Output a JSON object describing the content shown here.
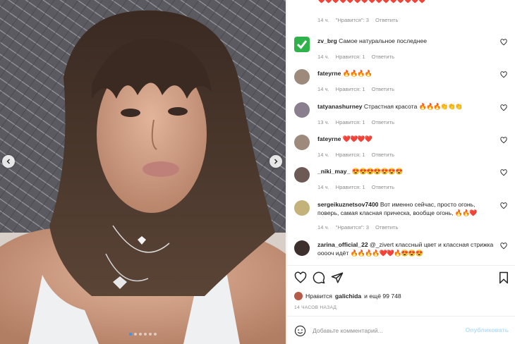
{
  "post": {
    "carousel": {
      "slide_count": 6,
      "active_slide": 0
    }
  },
  "comments": [
    {
      "user": "",
      "text": "",
      "emoji": "❤️❤️❤️❤️❤️❤️❤️❤️❤️❤️❤️❤️❤️❤️❤️",
      "time": "14 ч.",
      "likes": "\"Нравится\": 3",
      "reply": "Ответить",
      "avatar_color": "#c45a9b"
    },
    {
      "user": "zv_brg",
      "text": "Самое натуральное последнее",
      "emoji": "",
      "time": "14 ч.",
      "likes": "Нравится: 1",
      "reply": "Ответить",
      "avatar_color": "#2fb24a"
    },
    {
      "user": "fateyrne",
      "text": "",
      "emoji": "🔥🔥🔥🔥",
      "time": "14 ч.",
      "likes": "Нравится: 1",
      "reply": "Ответить",
      "avatar_color": "#9d8a7c"
    },
    {
      "user": "tatyanashurney",
      "text": "Страстная красота",
      "emoji": "🔥🔥🔥👏👏👏",
      "time": "13 ч.",
      "likes": "Нравится: 1",
      "reply": "Ответить",
      "avatar_color": "#8a7f8f"
    },
    {
      "user": "fateyrne",
      "text": "",
      "emoji": "❤️❤️❤️❤️",
      "time": "14 ч.",
      "likes": "Нравится: 1",
      "reply": "Ответить",
      "avatar_color": "#9d8a7c"
    },
    {
      "user": "_niki_may_",
      "text": "",
      "emoji": "😍😍😍😍😍😍😍",
      "time": "14 ч.",
      "likes": "Нравится: 1",
      "reply": "Ответить",
      "avatar_color": "#6e5a55"
    },
    {
      "user": "sergeikuznetsov7400",
      "text": "Вот именно сейчас, просто огонь, поверь, самая класная прическа, вообще огонь,",
      "emoji": "🔥🔥❤️",
      "time": "14 ч.",
      "likes": "\"Нравится\": 3",
      "reply": "Ответить",
      "avatar_color": "#c3b27a"
    },
    {
      "user": "zarina_official_22",
      "text": "@_zivert классный цвет и классная стрижка ооооч идёт",
      "emoji": "🔥🔥🔥🔥❤️❤️🔥😍😍😍",
      "time": "",
      "likes": "",
      "reply": "",
      "avatar_color": "#3c2f2c"
    }
  ],
  "actions": {
    "likes_prefix": "Нравится",
    "liker": "galichida",
    "likes_suffix": "и ещё 99 748",
    "timestamp": "14 ЧАСОВ НАЗАД"
  },
  "add_comment": {
    "placeholder": "Добавьте комментарий...",
    "publish_label": "Опубликовать"
  },
  "colors": {
    "accent": "#3897f0",
    "publish_disabled": "#b2dffc",
    "meta": "#8e8e8e"
  },
  "icons": [
    "chevron-left-icon",
    "chevron-right-icon",
    "heart-icon",
    "comment-icon",
    "share-icon",
    "bookmark-icon",
    "smile-icon"
  ]
}
